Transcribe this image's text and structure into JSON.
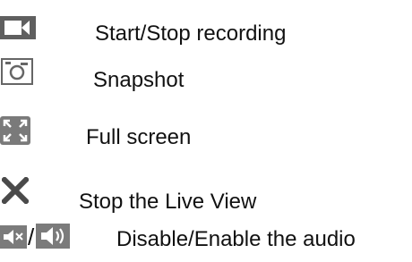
{
  "legend": {
    "items": [
      {
        "icon": "video-camera-icon",
        "label": "Start/Stop recording"
      },
      {
        "icon": "camera-icon",
        "label": "Snapshot"
      },
      {
        "icon": "fullscreen-icon",
        "label": "Full screen"
      },
      {
        "icon": "close-icon",
        "label": "Stop the Live View"
      },
      {
        "icon": "speaker-muted-icon",
        "separator": "/",
        "icon2": "speaker-on-icon",
        "label": "Disable/Enable the audio"
      }
    ]
  },
  "colors": {
    "icon_dark": "#4a4a4a",
    "icon_mid": "#777777",
    "text": "#111111",
    "background": "#ffffff"
  }
}
